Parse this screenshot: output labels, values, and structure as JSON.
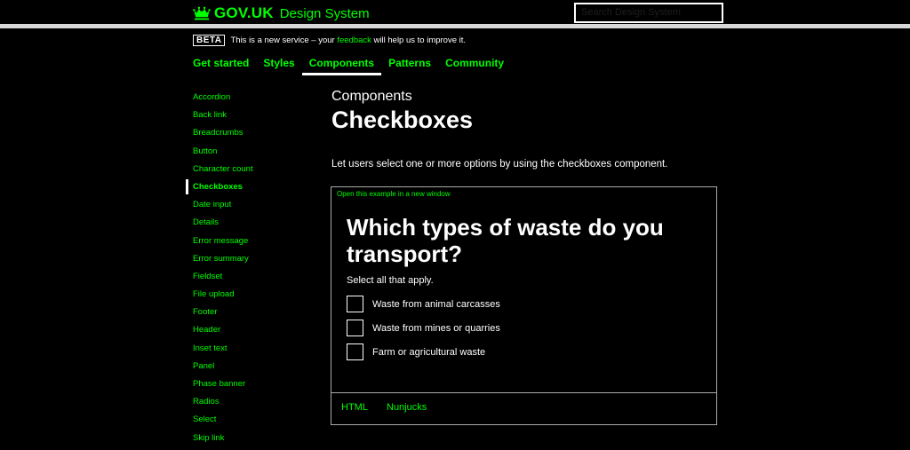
{
  "header": {
    "logo_text": "GOV.UK",
    "product_name": "Design System",
    "search_placeholder": "Search Design System"
  },
  "phase_banner": {
    "tag": "BETA",
    "text_before": "This is a new service – your",
    "link": "feedback",
    "text_after": "will help us to improve it."
  },
  "nav": {
    "items": [
      "Get started",
      "Styles",
      "Components",
      "Patterns",
      "Community"
    ],
    "active": "Components"
  },
  "sidebar": {
    "items": [
      "Accordion",
      "Back link",
      "Breadcrumbs",
      "Button",
      "Character count",
      "Checkboxes",
      "Date input",
      "Details",
      "Error message",
      "Error summary",
      "Fieldset",
      "File upload",
      "Footer",
      "Header",
      "Inset text",
      "Panel",
      "Phase banner",
      "Radios",
      "Select",
      "Skip link"
    ],
    "active": "Checkboxes"
  },
  "main": {
    "caption": "Components",
    "title": "Checkboxes",
    "lead": "Let users select one or more options by using the checkboxes component."
  },
  "example": {
    "open_link": "Open this example in a new window",
    "question": "Which types of waste do you transport?",
    "hint": "Select all that apply.",
    "options": [
      {
        "label": "Waste from animal carcasses",
        "checked": false
      },
      {
        "label": "Waste from mines or quarries",
        "checked": false
      },
      {
        "label": "Farm or agricultural waste",
        "checked": false
      }
    ]
  },
  "code_tabs": [
    "HTML",
    "Nunjucks"
  ],
  "colors": {
    "background": "#000000",
    "link": "#00ff00",
    "text": "#ffffff",
    "border": "#aaaaaa"
  }
}
